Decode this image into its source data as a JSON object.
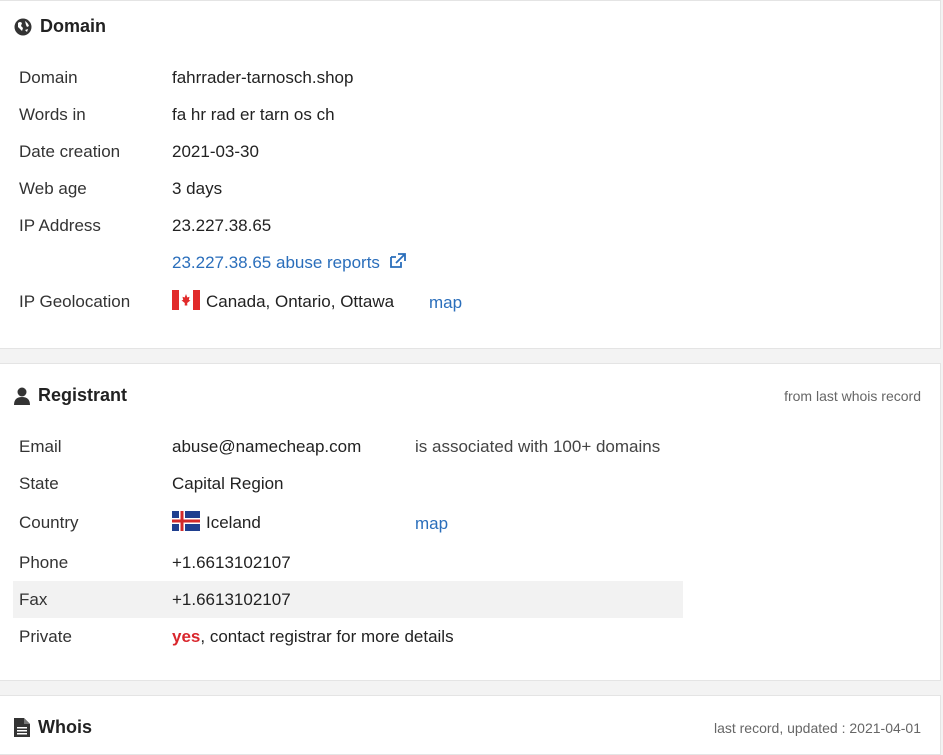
{
  "domain_section": {
    "title": "Domain",
    "rows": {
      "domain": {
        "label": "Domain",
        "value": "fahrrader-tarnosch.shop"
      },
      "words": {
        "label": "Words in",
        "value": "fa hr rad er tarn os ch"
      },
      "created": {
        "label": "Date creation",
        "value": "2021-03-30"
      },
      "age": {
        "label": "Web age",
        "value": "3 days"
      },
      "ip": {
        "label": "IP Address",
        "value": "23.227.38.65"
      },
      "abuse": {
        "value": "23.227.38.65 abuse reports"
      },
      "geo": {
        "label": "IP Geolocation",
        "value": "Canada, Ontario, Ottawa",
        "map": "map",
        "flag": "canada-flag"
      }
    }
  },
  "registrant_section": {
    "title": "Registrant",
    "note": "from last whois record",
    "rows": {
      "email": {
        "label": "Email",
        "value": "abuse@namecheap.com",
        "extra": "is associated with 100+ domains"
      },
      "state": {
        "label": "State",
        "value": "Capital Region"
      },
      "country": {
        "label": "Country",
        "value": "Iceland",
        "map": "map",
        "flag": "iceland-flag"
      },
      "phone": {
        "label": "Phone",
        "value": "+1.6613102107"
      },
      "fax": {
        "label": "Fax",
        "value": "+1.6613102107"
      },
      "private": {
        "label": "Private",
        "flag_word": "yes",
        "rest": ", contact registrar for more details"
      }
    }
  },
  "whois_section": {
    "title": "Whois",
    "note": "last record, updated : 2021-04-01"
  },
  "colors": {
    "link": "#2a6ebb",
    "red": "#d9262c"
  }
}
